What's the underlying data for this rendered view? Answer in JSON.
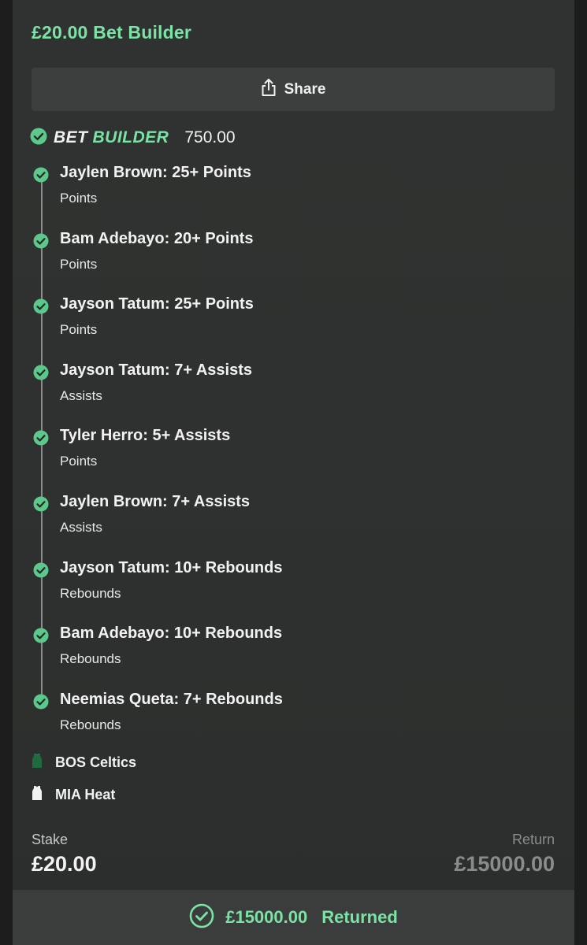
{
  "header": {
    "title": "£20.00 Bet Builder"
  },
  "share_button": {
    "label": "Share",
    "icon": "share-icon"
  },
  "bet_builder": {
    "word_bet": "BET",
    "word_builder": "BUILDER",
    "odds": "750.00",
    "accent_color": "#7be3a5"
  },
  "legs": [
    {
      "selection": "Jaylen Brown: 25+ Points",
      "market": "Points"
    },
    {
      "selection": "Bam Adebayo: 20+ Points",
      "market": "Points"
    },
    {
      "selection": "Jayson Tatum: 25+ Points",
      "market": "Points"
    },
    {
      "selection": "Jayson Tatum: 7+ Assists",
      "market": "Assists"
    },
    {
      "selection": "Tyler Herro: 5+ Assists",
      "market": "Points"
    },
    {
      "selection": "Jaylen Brown: 7+ Assists",
      "market": "Assists"
    },
    {
      "selection": "Jayson Tatum: 10+ Rebounds",
      "market": "Rebounds"
    },
    {
      "selection": "Bam Adebayo: 10+ Rebounds",
      "market": "Rebounds"
    },
    {
      "selection": "Neemias Queta: 7+ Rebounds",
      "market": "Rebounds"
    }
  ],
  "teams": [
    {
      "name": "BOS Celtics",
      "icon": "green-jersey-icon",
      "color": "#1f6b3d"
    },
    {
      "name": "MIA Heat",
      "icon": "white-jersey-icon",
      "color": "#f2f2f2"
    }
  ],
  "summary": {
    "stake_label": "Stake",
    "stake_value": "£20.00",
    "return_label": "Return",
    "return_value": "£15000.00"
  },
  "footer": {
    "amount": "£15000.00",
    "status": "Returned",
    "icon": "check-circle-icon"
  }
}
